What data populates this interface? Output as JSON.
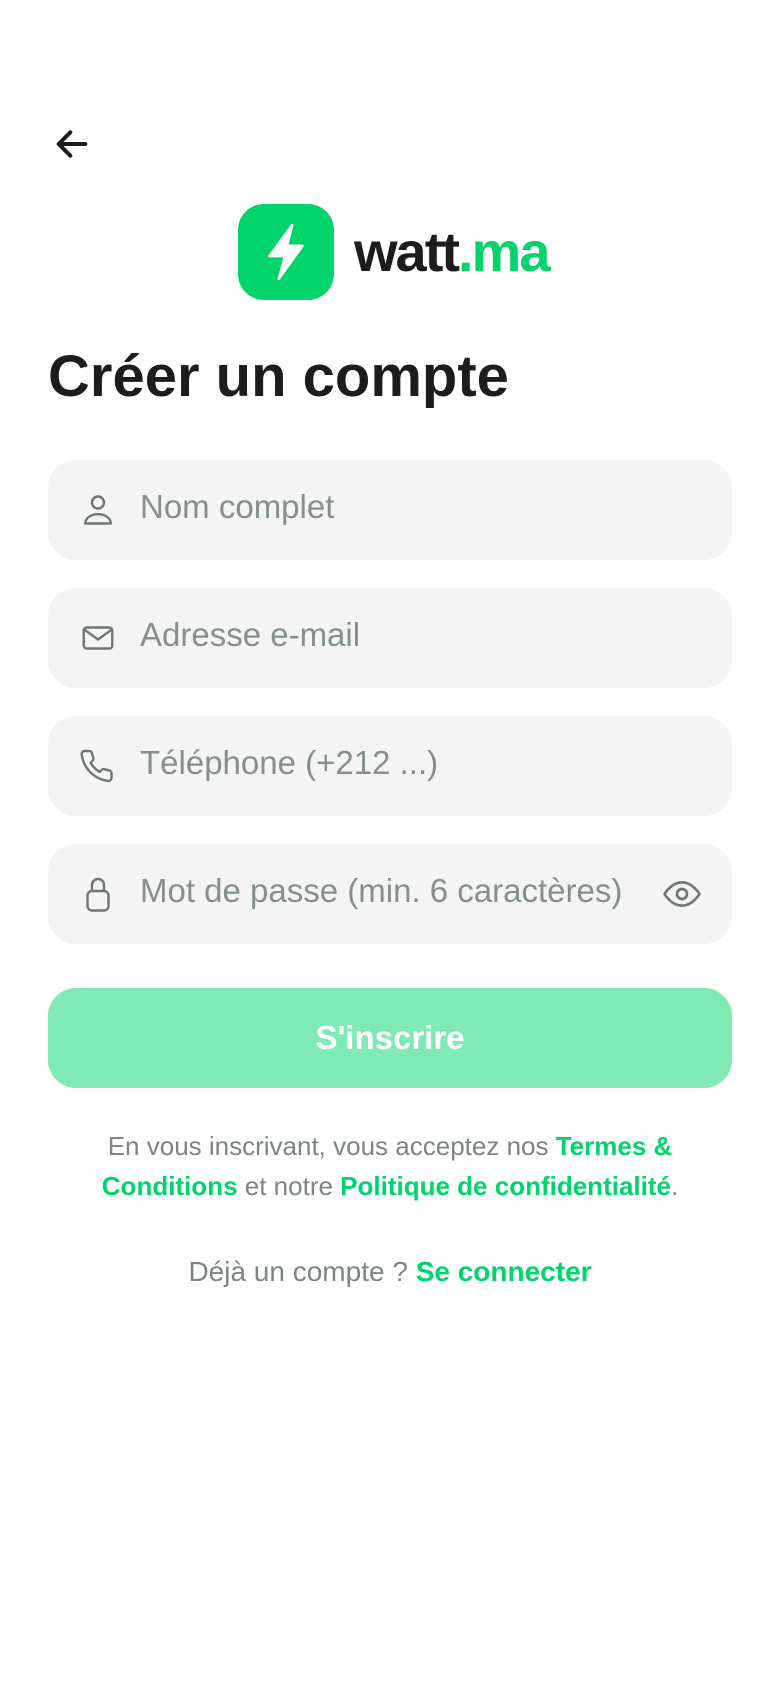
{
  "header": {
    "back_icon": "arrow-left-icon"
  },
  "brand": {
    "logo_icon": "lightning-bolt-icon",
    "name": "watt",
    "suffix": ".ma",
    "accent_color": "#00d46b"
  },
  "page": {
    "title": "Créer un compte"
  },
  "form": {
    "full_name": {
      "icon": "user-icon",
      "placeholder": "Nom complet",
      "value": ""
    },
    "email": {
      "icon": "envelope-icon",
      "placeholder": "Adresse e-mail",
      "value": ""
    },
    "phone": {
      "icon": "phone-icon",
      "placeholder": "Téléphone (+212 ...)",
      "value": ""
    },
    "password": {
      "icon": "lock-icon",
      "placeholder": "Mot de passe (min. 6 caractères)",
      "value": "",
      "toggle_icon": "eye-icon"
    },
    "submit_label": "S'inscrire",
    "submit_color": "#80eab4"
  },
  "legal": {
    "prefix": "En vous inscrivant, vous acceptez nos ",
    "terms_link": "Termes & Conditions",
    "middle": " et notre ",
    "privacy_link": "Politique de confidentialité",
    "suffix": "."
  },
  "login": {
    "prompt": "Déjà un compte ?",
    "link": "Se connecter"
  }
}
